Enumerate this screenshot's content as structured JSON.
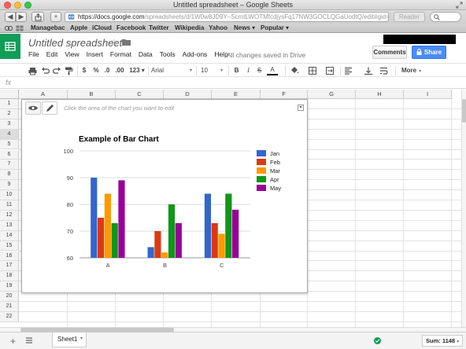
{
  "window": {
    "title": "Untitled spreadsheet – Google Sheets"
  },
  "browser": {
    "url_prefix": "https://",
    "url_domain": "docs.google.com",
    "url_path": "/spreadsheets/d/1W0w8JD9Y–ScmtLWOTMfcdjysFq17NW3GOCLQGaUodtQ/edit#gid=0",
    "reader_label": "Reader",
    "bookmarks": [
      "Managebac",
      "Apple",
      "iCloud",
      "Facebook",
      "Twitter",
      "Wikipedia",
      "Yahoo",
      "News ▾",
      "Popular ▾"
    ]
  },
  "doc": {
    "title": "Untitled spreadsheet",
    "menu": [
      "File",
      "Edit",
      "View",
      "Insert",
      "Format",
      "Data",
      "Tools",
      "Add-ons",
      "Help"
    ],
    "save_status": "All changes saved in Drive",
    "comments_label": "Comments",
    "share_label": "Share"
  },
  "toolbar": {
    "currency": "$",
    "percent": "%",
    "dec_less": ".0",
    "dec_more": ".00",
    "number_format": "123 ▾",
    "font": "Arial",
    "font_size": "10",
    "bold": "B",
    "italic": "I",
    "strike": "S",
    "text_color": "A",
    "more_label": "More"
  },
  "formula_bar": {
    "label": "fx"
  },
  "grid": {
    "columns": [
      "A",
      "B",
      "C",
      "D",
      "E",
      "F",
      "G",
      "H",
      "I"
    ],
    "rows": [
      "1",
      "2",
      "3",
      "4",
      "5",
      "6",
      "7",
      "8",
      "9",
      "10",
      "11",
      "12",
      "13",
      "14",
      "15",
      "16",
      "17",
      "18",
      "19",
      "20",
      "21",
      "22"
    ]
  },
  "chart_panel": {
    "hint": "Click the area of the chart you want to edit"
  },
  "chart_data": {
    "type": "bar",
    "title": "Example of Bar Chart",
    "categories": [
      "A",
      "B",
      "C"
    ],
    "series": [
      {
        "name": "Jan",
        "color": "#3366cc",
        "values": [
          90,
          64,
          84
        ]
      },
      {
        "name": "Feb",
        "color": "#dc3912",
        "values": [
          75,
          70,
          73
        ]
      },
      {
        "name": "Mar",
        "color": "#ff9900",
        "values": [
          84,
          62,
          69
        ]
      },
      {
        "name": "Apr",
        "color": "#109618",
        "values": [
          73,
          80,
          84
        ]
      },
      {
        "name": "May",
        "color": "#990099",
        "values": [
          89,
          73,
          78
        ]
      }
    ],
    "ylim": [
      60,
      100
    ],
    "yticks": [
      60,
      70,
      80,
      90,
      100
    ],
    "grid": true,
    "legend": "right"
  },
  "bottom": {
    "sheet_tab": "Sheet1",
    "sum_label": "Sum: 1148"
  }
}
